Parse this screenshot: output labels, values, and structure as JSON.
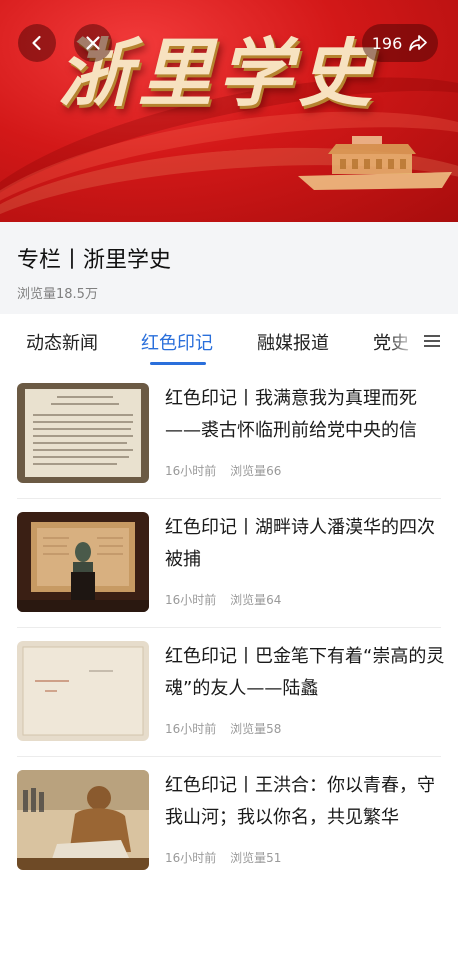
{
  "banner": {
    "title": "浙里学史",
    "share_count": "196"
  },
  "column": {
    "title": "专栏丨浙里学史",
    "views": "浏览量18.5万"
  },
  "tabs": [
    {
      "label": "动态新闻",
      "active": false
    },
    {
      "label": "红色印记",
      "active": true
    },
    {
      "label": "融媒报道",
      "active": false
    },
    {
      "label": "党史",
      "active": false
    }
  ],
  "articles": [
    {
      "title": "红色印记丨我满意我为真理而死——裘古怀临刑前给党中央的信",
      "time": "16小时前",
      "views": "浏览量66"
    },
    {
      "title": "红色印记丨湖畔诗人潘漠华的四次被捕",
      "time": "16小时前",
      "views": "浏览量64"
    },
    {
      "title": "红色印记丨巴金笔下有着“崇高的灵魂”的友人——陆蠡",
      "time": "16小时前",
      "views": "浏览量58"
    },
    {
      "title": "红色印记丨王洪合：你以青春，守我山河；我以你名，共见繁华",
      "time": "16小时前",
      "views": "浏览量51"
    }
  ],
  "colors": {
    "accent": "#2a6fdb",
    "banner_red": "#d31818"
  }
}
